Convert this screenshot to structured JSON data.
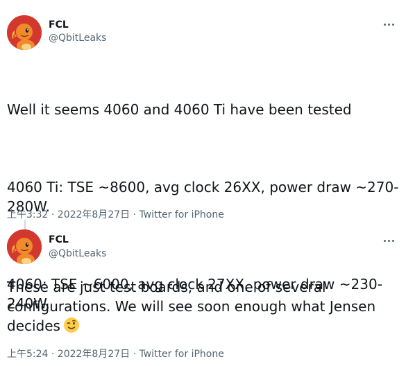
{
  "tweets": [
    {
      "author_name": "FCL",
      "author_handle": "@QbitLeaks",
      "paragraphs": [
        "Well it seems 4060 and 4060 Ti have been tested",
        "4060 Ti: TSE ~8600, avg clock 26XX, power draw ~270-280W.",
        "4060: TSE ~6000, avg clock 27XX, power draw ~230-240W."
      ],
      "timestamp": "上午3:32 · 2022年8月27日 · ",
      "source": "Twitter for iPhone",
      "avatar_icon": "charmander-avatar-icon",
      "more_icon": "more-options-icon"
    },
    {
      "author_name": "FCL",
      "author_handle": "@QbitLeaks",
      "text": "These are just test boards, and one of several configurations. We will see soon enough what Jensen decides",
      "emoji": "winking-face-icon",
      "timestamp": "上午5:24 · 2022年8月27日 · ",
      "source": "Twitter for iPhone",
      "avatar_icon": "charmander-avatar-icon",
      "more_icon": "more-options-icon"
    }
  ],
  "colors": {
    "text": "#0f1419",
    "secondary": "#536471",
    "avatar_bg": "#d3382f",
    "thread_line": "#cfd9de"
  }
}
